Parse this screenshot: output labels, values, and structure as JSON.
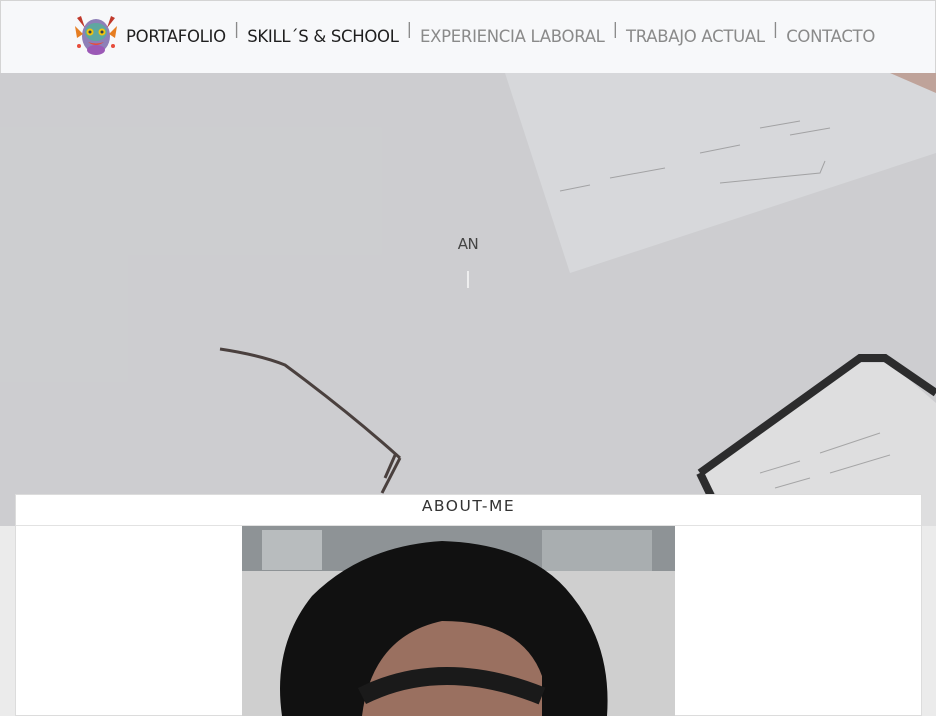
{
  "nav": {
    "items": [
      {
        "label": "PORTAFOLIO",
        "active": true
      },
      {
        "label": "SKILL´S & SCHOOL",
        "active": true
      },
      {
        "label": "EXPERIENCIA LABORAL",
        "active": false
      },
      {
        "label": "TRABAJO ACTUAL",
        "active": false
      },
      {
        "label": "CONTACTO",
        "active": false
      }
    ],
    "separator": "|"
  },
  "hero": {
    "title": "AN",
    "cursor": "|"
  },
  "about": {
    "heading": "ABOUT-ME"
  },
  "colors": {
    "nav_bg": "#f7f8fa",
    "hero_bg": "#d9dadc",
    "page_bg": "#ebebeb"
  }
}
